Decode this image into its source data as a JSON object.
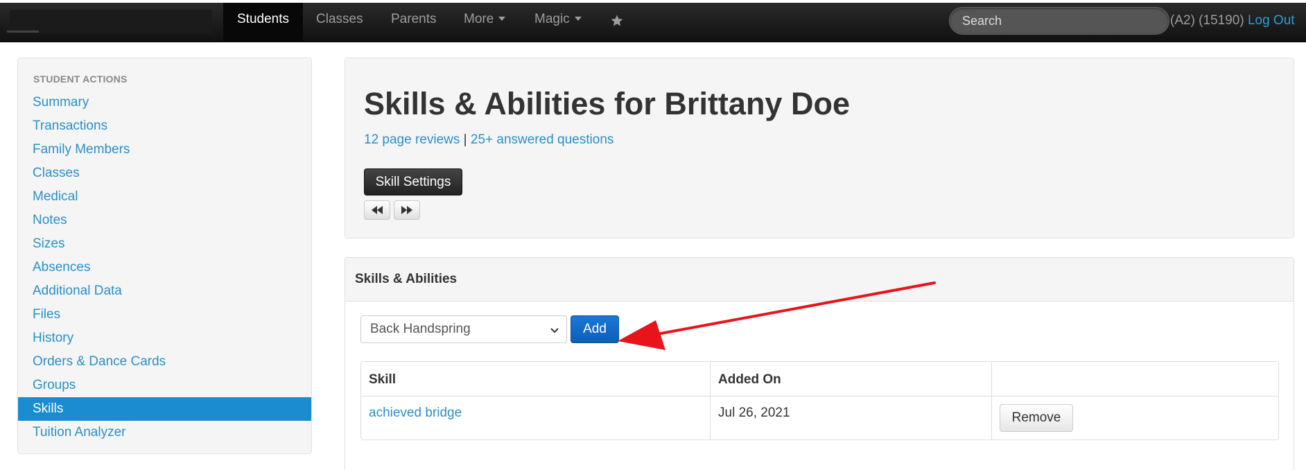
{
  "navbar": {
    "items": [
      {
        "label": "Students",
        "active": true
      },
      {
        "label": "Classes"
      },
      {
        "label": "Parents"
      },
      {
        "label": "More",
        "dropdown": true
      },
      {
        "label": "Magic",
        "dropdown": true
      }
    ],
    "star_icon": "star-icon",
    "search_placeholder": "Search",
    "user_info": "(A2) (15190) ",
    "logout_label": "Log Out"
  },
  "sidebar": {
    "header": "STUDENT ACTIONS",
    "items": [
      {
        "label": "Summary"
      },
      {
        "label": "Transactions"
      },
      {
        "label": "Family Members"
      },
      {
        "label": "Classes"
      },
      {
        "label": "Medical"
      },
      {
        "label": "Notes"
      },
      {
        "label": "Sizes"
      },
      {
        "label": "Absences"
      },
      {
        "label": "Additional Data"
      },
      {
        "label": "Files"
      },
      {
        "label": "History"
      },
      {
        "label": "Orders & Dance Cards"
      },
      {
        "label": "Groups"
      },
      {
        "label": "Skills",
        "active": true
      },
      {
        "label": "Tuition Analyzer"
      }
    ]
  },
  "hero": {
    "title": "Skills & Abilities for Brittany Doe",
    "reviews_link": "12 page reviews",
    "separator": " | ",
    "questions_link": "25+ answered questions",
    "settings_button": "Skill Settings",
    "prev_icon": "backward-icon",
    "next_icon": "forward-icon"
  },
  "panel": {
    "title": "Skills & Abilities",
    "select_value": "Back Handspring",
    "add_button": "Add",
    "table": {
      "headers": [
        "Skill",
        "Added On",
        ""
      ],
      "rows": [
        {
          "skill": "achieved bridge",
          "added_on": "Jul 26, 2021",
          "action": "Remove"
        }
      ]
    }
  },
  "colors": {
    "link": "#2a8fc8",
    "active_sidebar": "#1b8ccf",
    "add_button": "#0d5fb8",
    "annotation_arrow": "#e8141c"
  }
}
